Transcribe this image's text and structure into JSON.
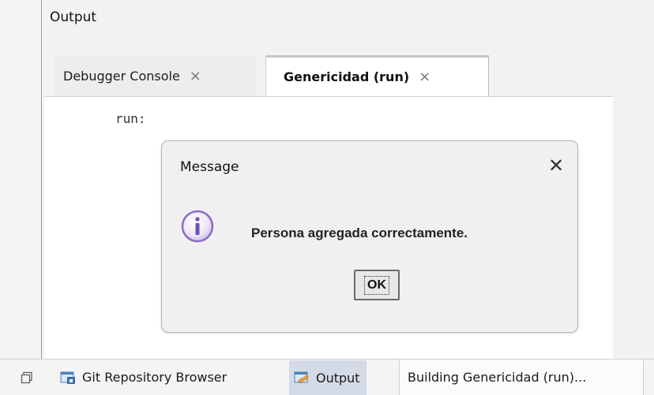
{
  "panel": {
    "title": "Output"
  },
  "tabs": [
    {
      "label": "Debugger Console",
      "close": "×"
    },
    {
      "label": "Genericidad (run)",
      "close": "×"
    }
  ],
  "console": {
    "text": "run:"
  },
  "dialog": {
    "title": "Message",
    "close": "✕",
    "message": "Persona agregada correctamente.",
    "ok_label": "OK"
  },
  "bottom_bar": {
    "git_label": "Git Repository Browser",
    "output_label": "Output",
    "status_label": "Building Genericidad (run)..."
  },
  "icons": {
    "rerun": "double-arrow-right-icon",
    "stop": "stop-icon",
    "settings": "settings-icon",
    "info": "info-icon",
    "restore": "restore-window-icon"
  },
  "colors": {
    "green_arrow": "#6cc24a",
    "stop_red": "#e0414a",
    "info_purple": "#8a6cc7",
    "selected_tab_bg": "#d4dbe7"
  }
}
